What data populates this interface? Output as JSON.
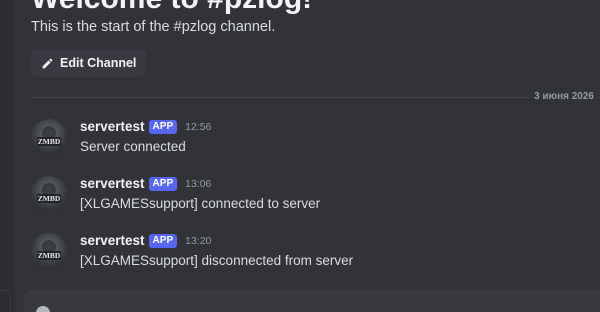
{
  "channel": {
    "welcome_title": "Welcome to #pzlog!",
    "welcome_subtitle": "This is the start of the #pzlog channel.",
    "edit_button_label": "Edit Channel",
    "edit_icon": "pencil-icon"
  },
  "divider": {
    "date": "3 июня 2026"
  },
  "messages": [
    {
      "username": "servertest",
      "badge": "APP",
      "time": "12:56",
      "text": "Server connected",
      "avatar_icon": "zomboid-avatar"
    },
    {
      "username": "servertest",
      "badge": "APP",
      "time": "13:06",
      "text": "[XLGAMESsupport] connected to server",
      "avatar_icon": "zomboid-avatar"
    },
    {
      "username": "servertest",
      "badge": "APP",
      "time": "13:20",
      "text": "[XLGAMESsupport] disconnected from server",
      "avatar_icon": "zomboid-avatar"
    }
  ],
  "colors": {
    "background": "#323339",
    "badge": "#5865f2",
    "username": "#f2f3f5",
    "timestamp": "#949ba4"
  }
}
